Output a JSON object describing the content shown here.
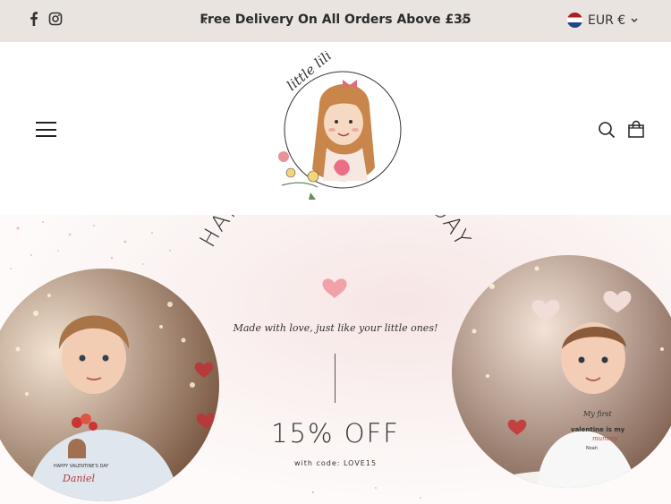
{
  "announcement": {
    "text": "Free Delivery On All Orders Above £35",
    "prev_label": "‹",
    "next_label": "›"
  },
  "social": {
    "icons": [
      "facebook-icon",
      "instagram-icon"
    ]
  },
  "currency": {
    "selected": "EUR €",
    "flag": "netherlands-flag-icon"
  },
  "header": {
    "logo_text": "little lili",
    "menu_icon": "hamburger-menu-icon",
    "search_icon": "search-icon",
    "cart_icon": "shopping-bag-icon"
  },
  "hero": {
    "headline": "HAPPY VALANTINES DAY",
    "tagline": "Made with love, just like your little ones!",
    "offer": "15% OFF",
    "code": "with code: LOVE15",
    "left_shirt_line1": "HAPPY VALENTINE'S DAY",
    "left_shirt_name": "Daniel",
    "right_shirt_line1": "My first",
    "right_shirt_line2": "valentine is my",
    "right_shirt_line3": "mummy",
    "right_shirt_name": "Noah"
  },
  "colors": {
    "announcement_bg": "#e9e4df",
    "accent_pink": "#e8929a",
    "text_dark": "#2b2b2b"
  }
}
